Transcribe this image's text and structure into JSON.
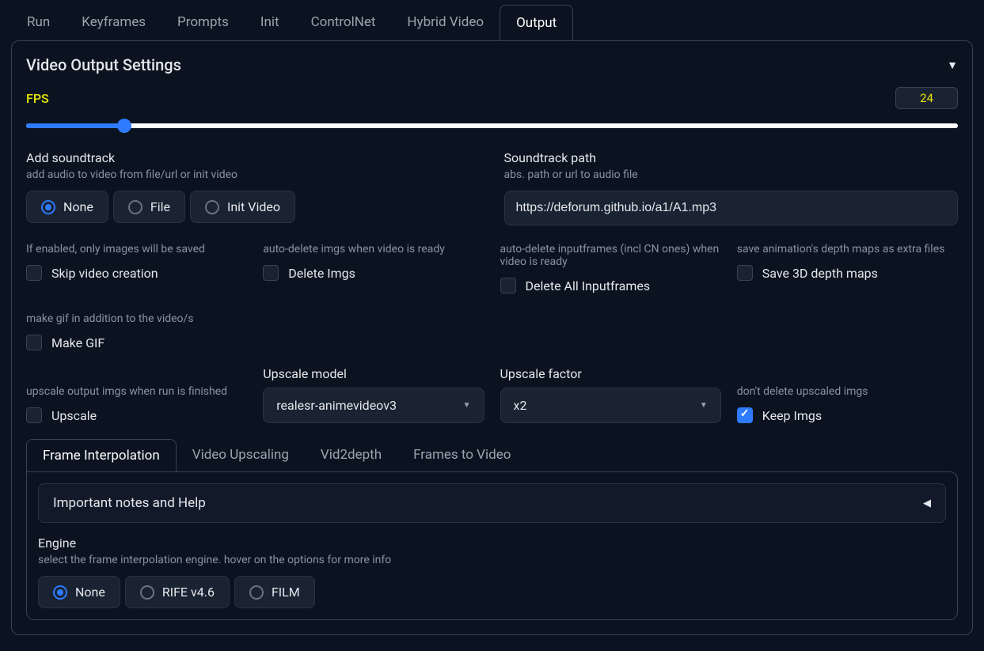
{
  "tabs": [
    "Run",
    "Keyframes",
    "Prompts",
    "Init",
    "ControlNet",
    "Hybrid Video",
    "Output"
  ],
  "activeTab": "Output",
  "section": {
    "title": "Video Output Settings"
  },
  "fps": {
    "label": "FPS",
    "value": "24"
  },
  "soundtrack": {
    "label": "Add soundtrack",
    "hint": "add audio to video from file/url or init video",
    "options": [
      "None",
      "File",
      "Init Video"
    ],
    "selected": "None"
  },
  "soundtrackPath": {
    "label": "Soundtrack path",
    "hint": "abs. path or url to audio file",
    "value": "https://deforum.github.io/a1/A1.mp3"
  },
  "skipVideo": {
    "hint": "If enabled, only images will be saved",
    "label": "Skip video creation"
  },
  "deleteImgs": {
    "hint": "auto-delete imgs when video is ready",
    "label": "Delete Imgs"
  },
  "deleteInput": {
    "hint": "auto-delete inputframes (incl CN ones) when video is ready",
    "label": "Delete All Inputframes"
  },
  "saveDepth": {
    "hint": "save animation's depth maps as extra files",
    "label": "Save 3D depth maps"
  },
  "makeGif": {
    "hint": "make gif in addition to the video/s",
    "label": "Make GIF"
  },
  "upscale": {
    "hint": "upscale output imgs when run is finished",
    "label": "Upscale"
  },
  "upscaleModel": {
    "label": "Upscale model",
    "value": "realesr-animevideov3"
  },
  "upscaleFactor": {
    "label": "Upscale factor",
    "value": "x2"
  },
  "keepImgs": {
    "hint": "don't delete upscaled imgs",
    "label": "Keep Imgs"
  },
  "subtabs": [
    "Frame Interpolation",
    "Video Upscaling",
    "Vid2depth",
    "Frames to Video"
  ],
  "activeSubtab": "Frame Interpolation",
  "accordion": {
    "title": "Important notes and Help"
  },
  "engine": {
    "label": "Engine",
    "hint": "select the frame interpolation engine. hover on the options for more info",
    "options": [
      "None",
      "RIFE v4.6",
      "FILM"
    ],
    "selected": "None"
  }
}
